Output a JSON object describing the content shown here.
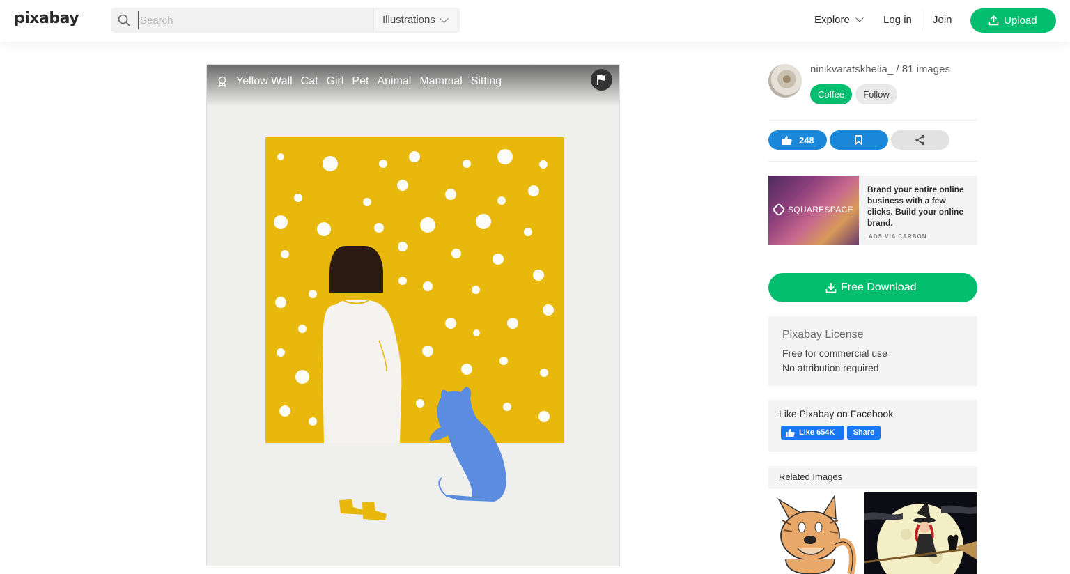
{
  "header": {
    "logo": "pixabay",
    "search_placeholder": "Search",
    "search_type": "Illustrations",
    "explore": "Explore",
    "login": "Log in",
    "join": "Join",
    "upload": "Upload"
  },
  "image": {
    "tags": [
      "Yellow Wall",
      "Cat",
      "Girl",
      "Pet",
      "Animal",
      "Mammal",
      "Sitting"
    ]
  },
  "user": {
    "line": "ninikvaratskhelia_ / 81 images",
    "coffee": "Coffee",
    "follow": "Follow"
  },
  "actions": {
    "likes": "248"
  },
  "ad": {
    "brand": "SQUARESPACE",
    "text": "Brand your entire online business with a few clicks. Build your online brand.",
    "via": "ADS VIA CARBON"
  },
  "download": {
    "label": "Free Download"
  },
  "license": {
    "title": "Pixabay License",
    "line1": "Free for commercial use",
    "line2": "No attribution required"
  },
  "facebook": {
    "title": "Like Pixabay on Facebook",
    "like": "Like 654K",
    "share": "Share"
  },
  "related": {
    "title": "Related Images"
  },
  "colors": {
    "green": "#02be6e",
    "blue": "#1a87d8",
    "wall_yellow": "#e8b90c",
    "cat_blue": "#5b8ce0"
  }
}
